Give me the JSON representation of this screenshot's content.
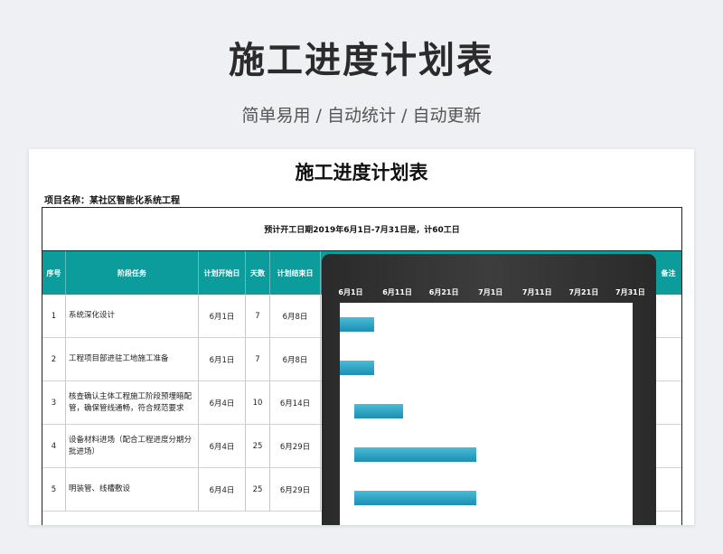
{
  "banner": {
    "title": "施工进度计划表",
    "subtitle": "简单易用  /  自动统计  /  自动更新"
  },
  "sheet": {
    "title": "施工进度计划表",
    "project_label": "项目名称：某社区智能化系统工程",
    "schedule_note": "预计开工日期2019年6月1日-7月31日是，计60工日"
  },
  "table": {
    "headers": {
      "seq": "序号",
      "task": "阶段任务",
      "start": "计划开始日",
      "days": "天数",
      "end": "计划结束日",
      "remarks": "备注"
    },
    "rows": [
      {
        "seq": "1",
        "task": "系统深化设计",
        "start": "6月1日",
        "days": "7",
        "end": "6月8日"
      },
      {
        "seq": "2",
        "task": "工程项目部进驻工地施工准备",
        "start": "6月1日",
        "days": "7",
        "end": "6月8日"
      },
      {
        "seq": "3",
        "task": "核查确认主体工程施工阶段预埋暗配管，确保管线通畅，符合规范要求",
        "start": "6月4日",
        "days": "10",
        "end": "6月14日"
      },
      {
        "seq": "4",
        "task": "设备材料进场（配合工程进度分期分批进场）",
        "start": "6月4日",
        "days": "25",
        "end": "6月29日"
      },
      {
        "seq": "5",
        "task": "明装管、线槽敷设",
        "start": "6月4日",
        "days": "25",
        "end": "6月29日"
      }
    ]
  },
  "chart_data": {
    "type": "bar",
    "orientation": "horizontal-gantt",
    "x_ticks": [
      "6月1日",
      "6月11日",
      "6月21日",
      "7月1日",
      "7月11日",
      "7月21日",
      "7月31日"
    ],
    "xlim": [
      "6月1日",
      "7月31日"
    ],
    "categories": [
      "系统深化设计",
      "工程项目部进驻工地施工准备",
      "核查确认主体工程施工阶段预埋暗配管，确保管线通畅，符合规范要求",
      "设备材料进场（配合工程进度分期分批进场）",
      "明装管、线槽敷设"
    ],
    "start": [
      "6月1日",
      "6月1日",
      "6月4日",
      "6月4日",
      "6月4日"
    ],
    "duration_days": [
      7,
      7,
      10,
      25,
      25
    ],
    "bar_color": "#2aa4c6"
  },
  "colors": {
    "header_bg": "#0d9c9c",
    "gantt_frame": "#333333",
    "bar": "#2aa4c6"
  }
}
